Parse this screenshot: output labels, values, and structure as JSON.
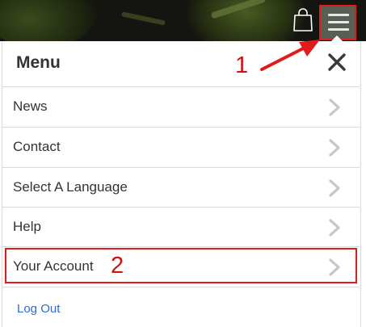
{
  "header": {
    "cart_icon": "shopping-bag-icon",
    "menu_icon": "hamburger-icon"
  },
  "menu": {
    "title": "Menu",
    "close_icon": "close-icon",
    "items": [
      {
        "label": "News",
        "icon": "chevron-right-icon"
      },
      {
        "label": "Contact",
        "icon": "chevron-right-icon"
      },
      {
        "label": "Select A Language",
        "icon": "chevron-right-icon"
      },
      {
        "label": "Help",
        "icon": "chevron-right-icon"
      },
      {
        "label": "Your Account",
        "icon": "chevron-right-icon"
      }
    ],
    "logout_label": "Log Out"
  },
  "annotations": {
    "step1": "1",
    "step2": "2",
    "highlight_color": "#e11a1a"
  },
  "colors": {
    "link": "#2e6ad0",
    "text": "#333333",
    "chevron": "#c8c8c8"
  }
}
